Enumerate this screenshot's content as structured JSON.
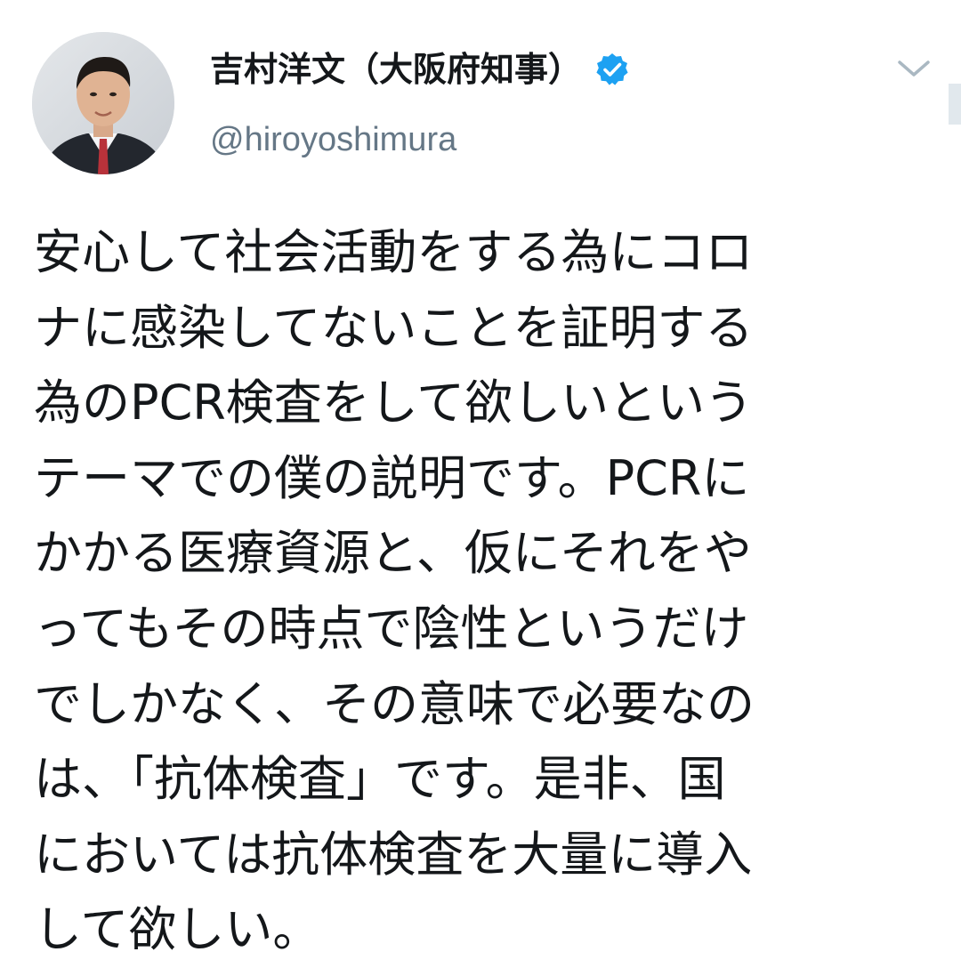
{
  "tweet": {
    "author": {
      "display_name": "吉村洋文（大阪府知事）",
      "handle": "@hiroyoshimura",
      "verified": true
    },
    "text_lines": [
      "安心して社会活動をする為にコロ",
      "ナに感染してないことを証明する",
      "為のPCR検査をして欲しいという",
      "テーマでの僕の説明です。PCRに",
      "かかる医療資源と、仮にそれをや",
      "ってもその時点で陰性というだけ",
      "でしかなく、その意味で必要なの",
      "は、「抗体検査」です。是非、国",
      "においては抗体検査を大量に導入",
      "して欲しい。"
    ]
  },
  "icons": {
    "verified": "verified-badge-icon",
    "menu": "chevron-down-icon"
  },
  "colors": {
    "verified_blue": "#1da1f2",
    "text_primary": "#14171a",
    "text_secondary": "#657786",
    "chevron_gray": "#aab8c2"
  }
}
